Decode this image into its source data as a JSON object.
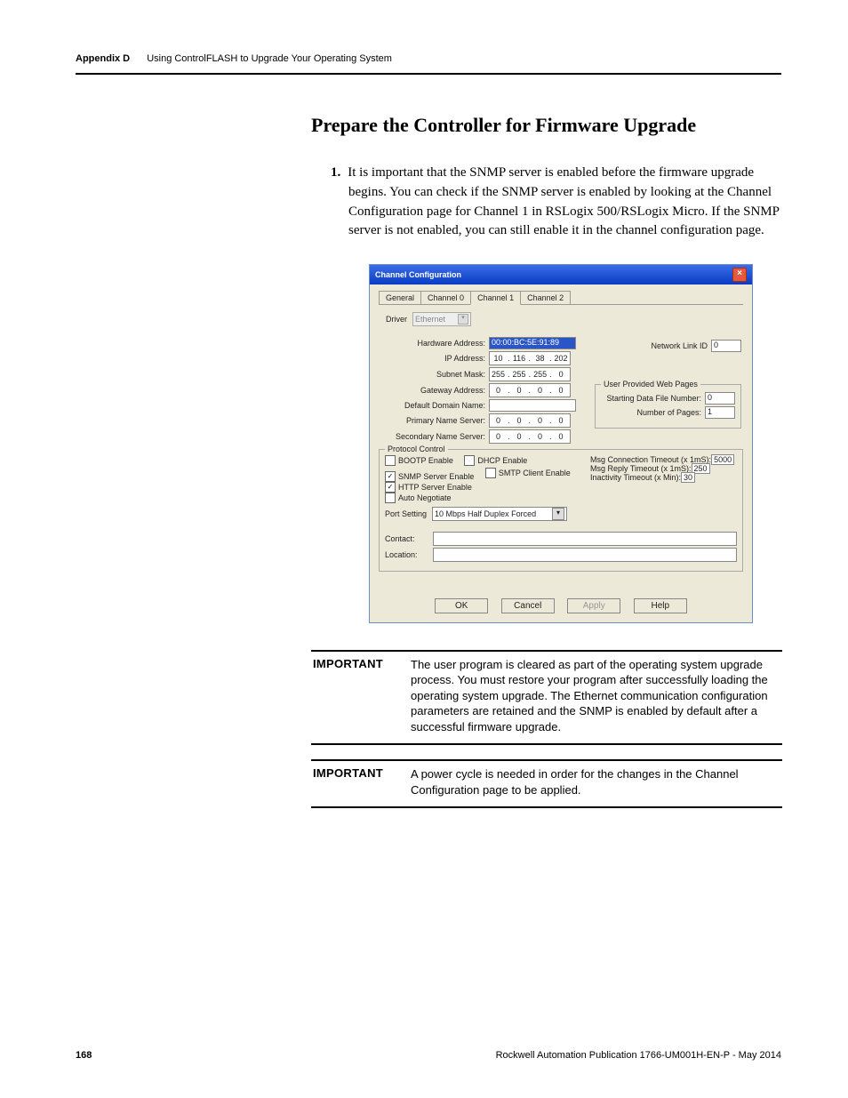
{
  "header": {
    "appendix": "Appendix D",
    "chapter": "Using ControlFLASH to Upgrade Your Operating System"
  },
  "section_title": "Prepare the Controller for Firmware Upgrade",
  "paragraph": {
    "num": "1.",
    "text": "It is important that the SNMP server is enabled before the firmware upgrade begins. You can check if the SNMP server is enabled by looking at the Channel Configuration page for Channel 1 in RSLogix 500/RSLogix Micro. If the SNMP server is not enabled, you can still enable it in the channel configuration page."
  },
  "dialog": {
    "title": "Channel Configuration",
    "tabs": [
      "General",
      "Channel 0",
      "Channel 1",
      "Channel 2"
    ],
    "active_tab": 2,
    "driver_label": "Driver",
    "driver_value": "Ethernet",
    "labels": {
      "hw": "Hardware Address:",
      "ip": "IP Address:",
      "subnet": "Subnet Mask:",
      "gw": "Gateway Address:",
      "domain": "Default Domain Name:",
      "pns": "Primary Name Server:",
      "sns": "Secondary Name Server:",
      "net_link": "Network Link ID",
      "uwplegend": "User Provided Web Pages",
      "startfile": "Starting Data File Number:",
      "numpages": "Number of Pages:",
      "protocol": "Protocol Control",
      "bootp": "BOOTP Enable",
      "dhcp": "DHCP Enable",
      "snmp": "SNMP Server Enable",
      "smtp": "SMTP Client Enable",
      "http": "HTTP Server Enable",
      "autoneg": "Auto Negotiate",
      "port": "Port Setting",
      "msgconn": "Msg Connection Timeout (x 1mS):",
      "msgrep": "Msg Reply Timeout (x 1mS):",
      "inact": "Inactivity Timeout (x Min):",
      "contact": "Contact:",
      "location": "Location:"
    },
    "hw_value": "00:00:BC:5E:91:89",
    "ip": [
      "10",
      "116",
      "38",
      "202"
    ],
    "subnet": [
      "255",
      "255",
      "255",
      "0"
    ],
    "gw": [
      "0",
      "0",
      "0",
      "0"
    ],
    "pns": [
      "0",
      "0",
      "0",
      "0"
    ],
    "sns": [
      "0",
      "0",
      "0",
      "0"
    ],
    "net_link_value": "0",
    "startfile_value": "0",
    "numpages_value": "1",
    "msgconn_value": "5000",
    "msgrep_value": "250",
    "inact_value": "30",
    "port_value": "10 Mbps Half Duplex Forced",
    "checks": {
      "bootp": false,
      "dhcp": false,
      "snmp": true,
      "smtp": false,
      "http": true,
      "autoneg": false
    },
    "buttons": {
      "ok": "OK",
      "cancel": "Cancel",
      "apply": "Apply",
      "help": "Help"
    }
  },
  "important1": {
    "label": "IMPORTANT",
    "text": "The user program is cleared as part of the operating system upgrade process. You must restore your program after successfully loading the operating system upgrade. The Ethernet communication configuration parameters are retained and the SNMP is enabled by default after a successful firmware upgrade."
  },
  "important2": {
    "label": "IMPORTANT",
    "text": "A power cycle is needed in order for the changes in the Channel Configuration page to be applied."
  },
  "footer": {
    "page": "168",
    "pub": "Rockwell Automation Publication 1766-UM001H-EN-P - May 2014"
  }
}
